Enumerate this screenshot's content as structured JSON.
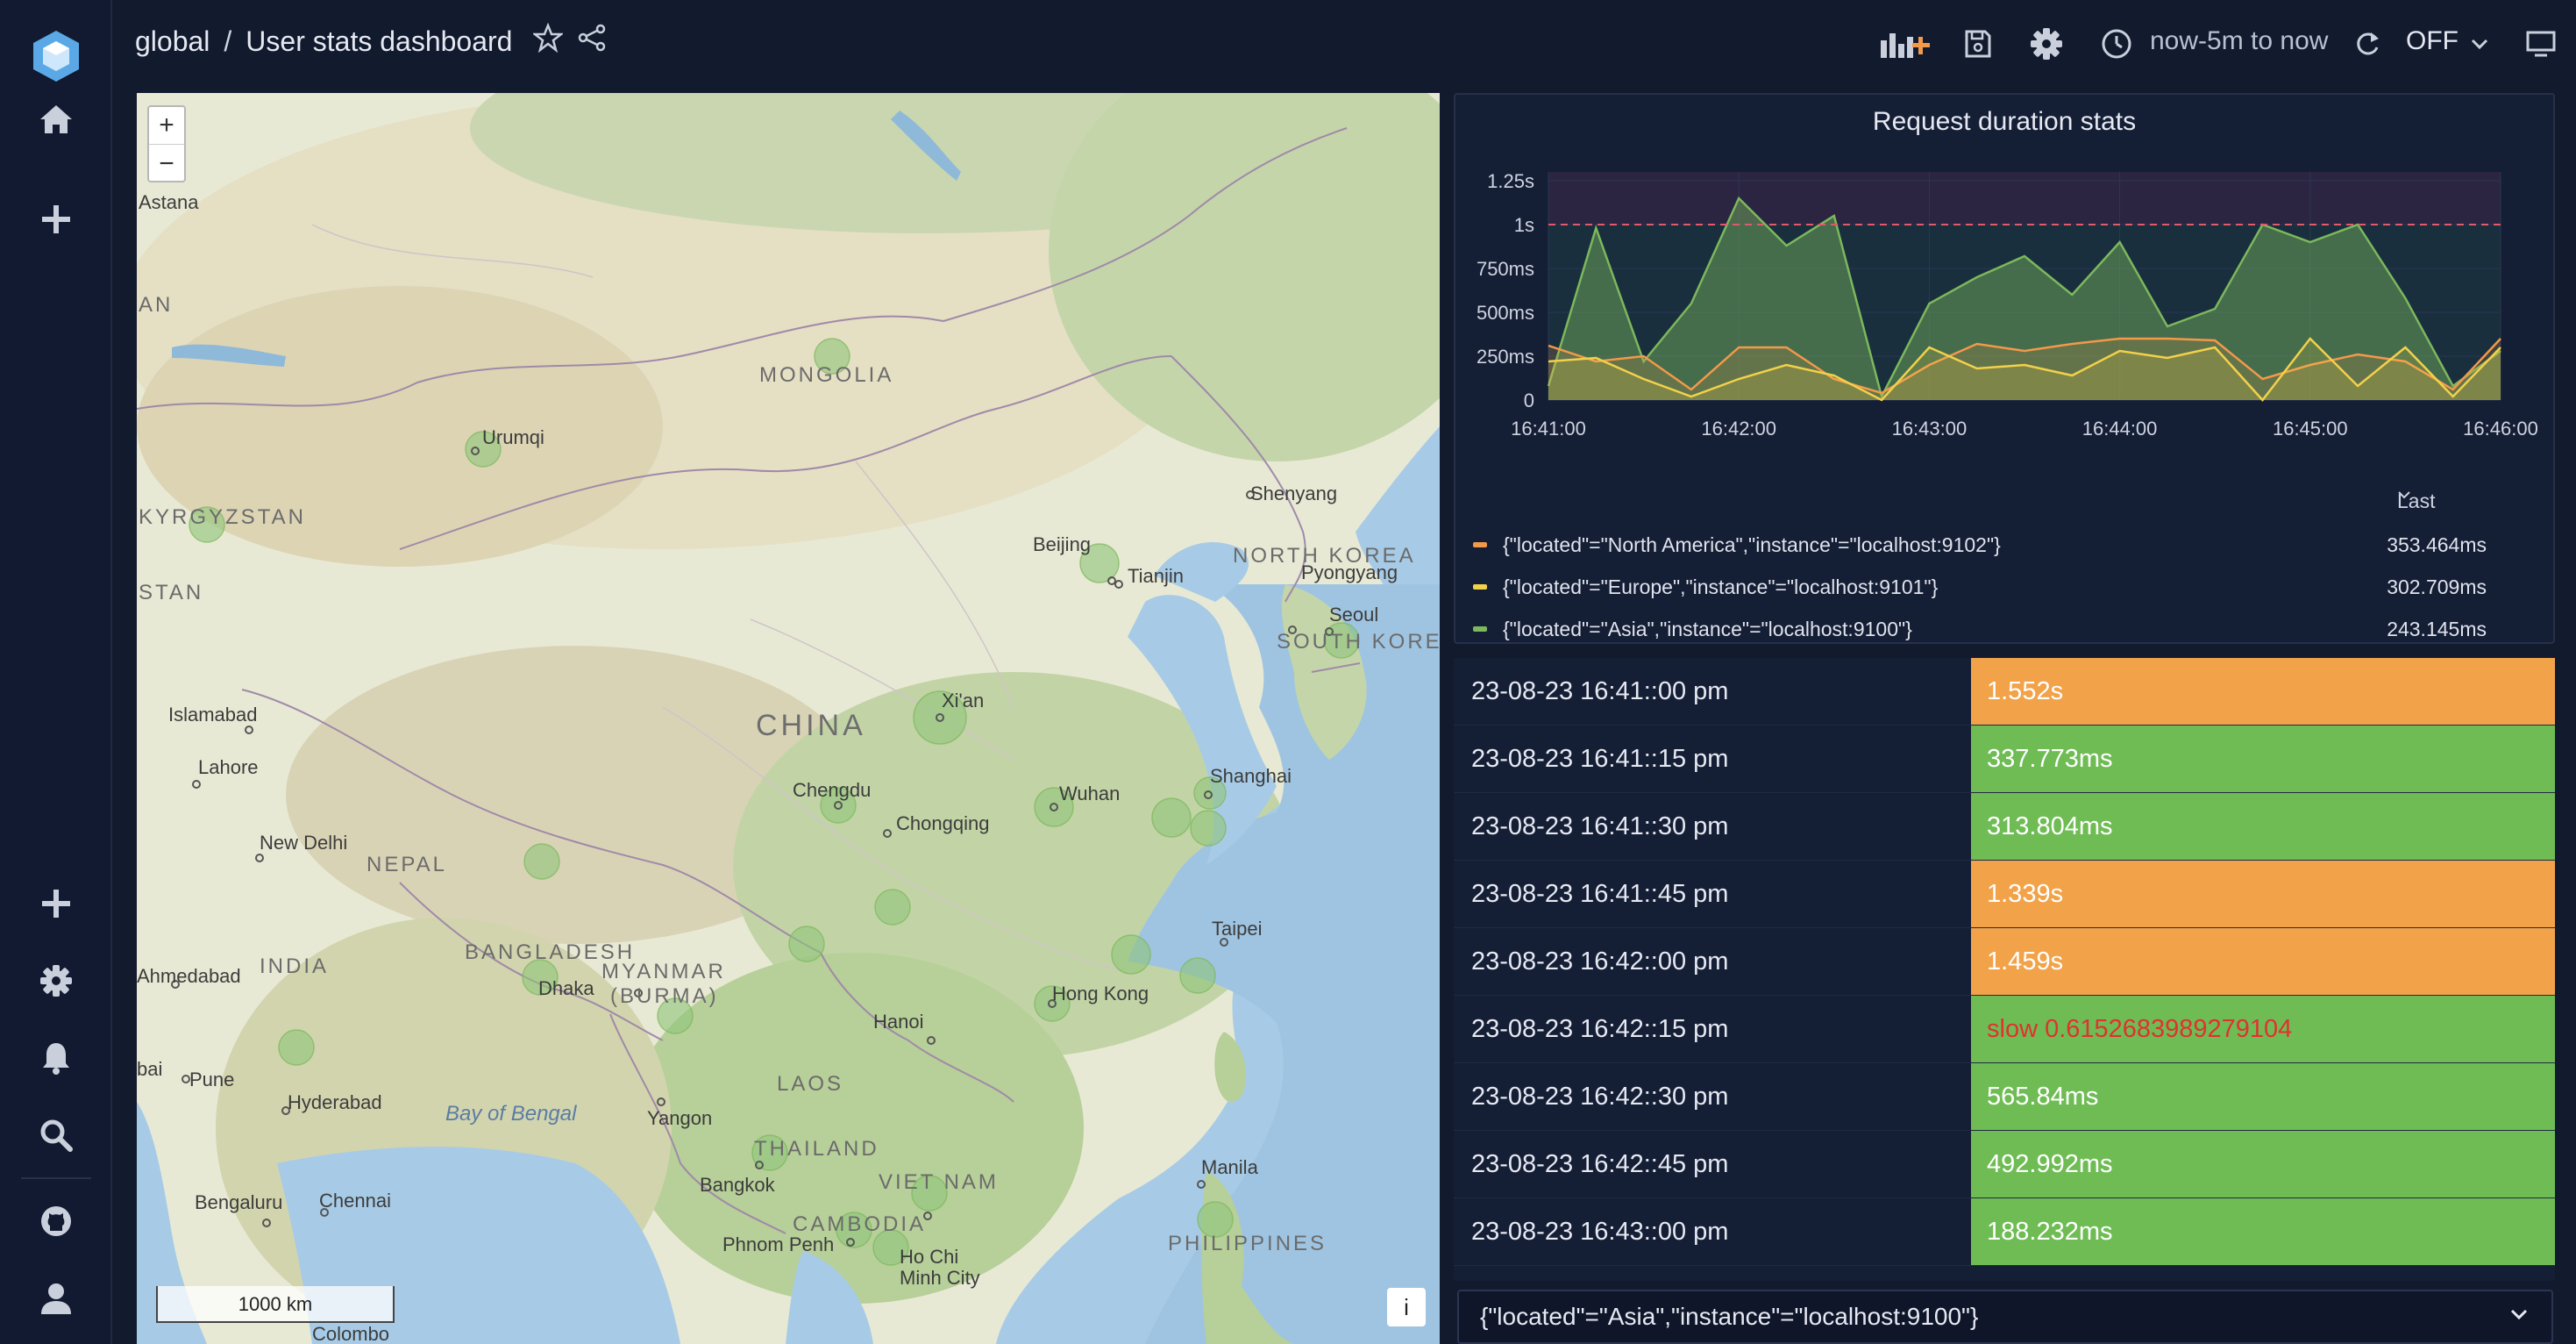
{
  "breadcrumb": {
    "folder": "global",
    "separator": "/",
    "title": "User stats dashboard"
  },
  "time_range": {
    "label": "now-5m to now"
  },
  "refresh": {
    "label": "OFF"
  },
  "map": {
    "zoom_in": "+",
    "zoom_out": "−",
    "scale_label": "1000 km",
    "info_label": "i",
    "labels": {
      "astana": "Astana",
      "an": "AN",
      "kyrgyzstan": "KYRGYZSTAN",
      "stan": "STAN",
      "urumqi": "Urumqi",
      "mongolia": "MONGOLIA",
      "shenyang": "Shenyang",
      "north_korea": "NORTH KOREA",
      "pyongyang": "Pyongyang",
      "beijing": "Beijing",
      "tianjin": "Tianjin",
      "seoul": "Seoul",
      "south_korea": "SOUTH KOREA",
      "islamabad": "Islamabad",
      "xian": "Xi'an",
      "china": "CHINA",
      "lahore": "Lahore",
      "chengdu": "Chengdu",
      "wuhan": "Wuhan",
      "shanghai": "Shanghai",
      "chongqing": "Chongqing",
      "new_delhi": "New Delhi",
      "nepal": "NEPAL",
      "taipei": "Taipei",
      "bangladesh": "BANGLADESH",
      "india": "INDIA",
      "ahmedabad": "Ahmedabad",
      "myanmar": "MYANMAR",
      "burma": "(BURMA)",
      "dhaka": "Dhaka",
      "hong_kong": "Hong Kong",
      "hanoi": "Hanoi",
      "bai": "bai",
      "pune": "Pune",
      "laos": "LAOS",
      "hyderabad": "Hyderabad",
      "bay_of_bengal": "Bay of Bengal",
      "yangon": "Yangon",
      "thailand": "THAILAND",
      "manila": "Manila",
      "bangkok": "Bangkok",
      "vietnam": "VIET NAM",
      "bengaluru": "Bengaluru",
      "chennai": "Chennai",
      "cambodia": "CAMBODIA",
      "phnom_penh": "Phnom Penh",
      "philippines": "PHILIPPINES",
      "ho_chi_minh": "Ho Chi",
      "minh_city": "Minh City",
      "colombo": "Colombo"
    }
  },
  "chart": {
    "title": "Request duration stats",
    "legend_header": "Last",
    "legend": [
      {
        "name": "{\"located\"=\"North America\",\"instance\"=\"localhost:9102\"}",
        "last": "353.464ms",
        "color": "#f2994a"
      },
      {
        "name": "{\"located\"=\"Europe\",\"instance\"=\"localhost:9101\"}",
        "last": "302.709ms",
        "color": "#f2d14a"
      },
      {
        "name": "{\"located\"=\"Asia\",\"instance\"=\"localhost:9100\"}",
        "last": "243.145ms",
        "color": "#7cb85c"
      }
    ]
  },
  "chart_data": {
    "type": "area",
    "title": "Request duration stats",
    "x_tick_labels": [
      "16:41:00",
      "16:42:00",
      "16:43:00",
      "16:44:00",
      "16:45:00",
      "16:46:00"
    ],
    "y_tick_labels": [
      "0",
      "250ms",
      "500ms",
      "750ms",
      "1s",
      "1.25s"
    ],
    "y_tick_values": [
      0,
      0.25,
      0.5,
      0.75,
      1.0,
      1.25
    ],
    "ylim": [
      0,
      1.3
    ],
    "threshold": 1.0,
    "x": [
      0,
      0.25,
      0.5,
      0.75,
      1.0,
      1.25,
      1.5,
      1.75,
      2.0,
      2.25,
      2.5,
      2.75,
      3.0,
      3.25,
      3.5,
      3.75,
      4.0,
      4.25,
      4.5,
      4.75,
      5.0
    ],
    "series": [
      {
        "name": "{\"located\"=\"Asia\",\"instance\"=\"localhost:9100\"}",
        "color": "#7cb85c",
        "values": [
          0.08,
          0.98,
          0.22,
          0.55,
          1.15,
          0.88,
          1.05,
          0.02,
          0.55,
          0.7,
          0.82,
          0.6,
          0.9,
          0.42,
          0.52,
          1.0,
          0.9,
          1.0,
          0.58,
          0.08,
          0.28
        ]
      },
      {
        "name": "{\"located\"=\"North America\",\"instance\"=\"localhost:9102\"}",
        "color": "#f2994a",
        "values": [
          0.31,
          0.22,
          0.25,
          0.06,
          0.3,
          0.3,
          0.12,
          0.04,
          0.2,
          0.32,
          0.28,
          0.32,
          0.35,
          0.35,
          0.34,
          0.12,
          0.2,
          0.26,
          0.22,
          0.06,
          0.35
        ]
      },
      {
        "name": "{\"located\"=\"Europe\",\"instance\"=\"localhost:9101\"}",
        "color": "#f2d14a",
        "values": [
          0.22,
          0.24,
          0.12,
          0.02,
          0.12,
          0.2,
          0.14,
          0.0,
          0.3,
          0.18,
          0.2,
          0.14,
          0.28,
          0.24,
          0.3,
          0.0,
          0.35,
          0.08,
          0.3,
          0.02,
          0.3
        ]
      }
    ]
  },
  "table": {
    "rows": [
      {
        "time": "23-08-23 16:41::00 pm",
        "value": "1.552s",
        "bg": "#f2a34a",
        "fg": "#ffffff"
      },
      {
        "time": "23-08-23 16:41::15 pm",
        "value": "337.773ms",
        "bg": "#6fbc55",
        "fg": "#ffffff"
      },
      {
        "time": "23-08-23 16:41::30 pm",
        "value": "313.804ms",
        "bg": "#6fbc55",
        "fg": "#ffffff"
      },
      {
        "time": "23-08-23 16:41::45 pm",
        "value": "1.339s",
        "bg": "#f2a34a",
        "fg": "#ffffff"
      },
      {
        "time": "23-08-23 16:42::00 pm",
        "value": "1.459s",
        "bg": "#f2a34a",
        "fg": "#ffffff"
      },
      {
        "time": "23-08-23 16:42::15 pm",
        "value": "slow 0.6152683989279104",
        "bg": "#6fbc55",
        "fg": "#e0322f"
      },
      {
        "time": "23-08-23 16:42::30 pm",
        "value": "565.84ms",
        "bg": "#6fbc55",
        "fg": "#ffffff"
      },
      {
        "time": "23-08-23 16:42::45 pm",
        "value": "492.992ms",
        "bg": "#6fbc55",
        "fg": "#ffffff"
      },
      {
        "time": "23-08-23 16:43::00 pm",
        "value": "188.232ms",
        "bg": "#6fbc55",
        "fg": "#ffffff"
      }
    ]
  },
  "series_select": {
    "value": "{\"located\"=\"Asia\",\"instance\"=\"localhost:9100\"}"
  },
  "colors": {
    "accent": "#5aa9e6",
    "background": "#121a2e",
    "panel": "#141e35"
  }
}
